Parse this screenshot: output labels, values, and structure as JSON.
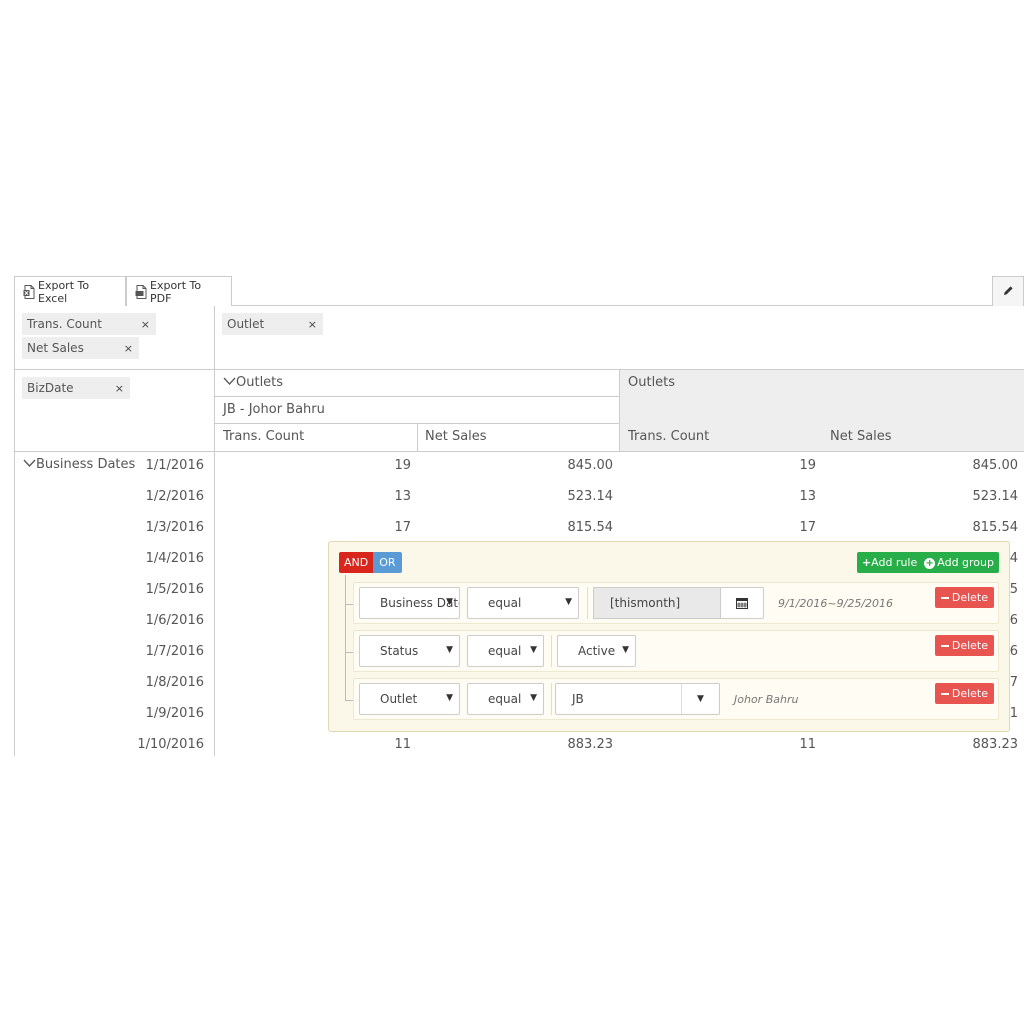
{
  "toolbar": {
    "export_excel_label": "Export To Excel",
    "export_pdf_label": "Export To PDF",
    "excel_icon": "excel-file-icon",
    "pdf_icon": "pdf-file-icon",
    "edit_icon": "pencil-icon"
  },
  "pivot": {
    "value_fields": [
      {
        "label": "Trans. Count",
        "remove": "×"
      },
      {
        "label": "Net Sales",
        "remove": "×"
      }
    ],
    "column_fields": [
      {
        "label": "Outlet",
        "remove": "×"
      }
    ],
    "row_fields": [
      {
        "label": "BizDate",
        "remove": "×"
      }
    ],
    "column_header": {
      "group_label": "Outlets",
      "outlet_label": "JB - Johor Bahru",
      "total_group_label": "Outlets",
      "measures": [
        "Trans. Count",
        "Net Sales",
        "Trans. Count",
        "Net Sales"
      ]
    },
    "row_header_label": "Business Dates",
    "rows": [
      {
        "date": "1/1/2016",
        "values": [
          "19",
          "845.00",
          "19",
          "845.00"
        ]
      },
      {
        "date": "1/2/2016",
        "values": [
          "13",
          "523.14",
          "13",
          "523.14"
        ]
      },
      {
        "date": "1/3/2016",
        "values": [
          "17",
          "815.54",
          "17",
          "815.54"
        ]
      },
      {
        "date": "1/4/2016",
        "values": [
          "",
          "",
          "",
          "4"
        ]
      },
      {
        "date": "1/5/2016",
        "values": [
          "",
          "",
          "",
          "5"
        ]
      },
      {
        "date": "1/6/2016",
        "values": [
          "",
          "",
          "",
          "6"
        ]
      },
      {
        "date": "1/7/2016",
        "values": [
          "",
          "",
          "",
          "6"
        ]
      },
      {
        "date": "1/8/2016",
        "values": [
          "",
          "",
          "",
          "7"
        ]
      },
      {
        "date": "1/9/2016",
        "values": [
          "",
          "",
          "",
          "1"
        ]
      },
      {
        "date": "1/10/2016",
        "values": [
          "11",
          "883.23",
          "11",
          "883.23"
        ]
      }
    ]
  },
  "filter": {
    "and_label": "AND",
    "or_label": "OR",
    "add_rule_label": "Add rule",
    "add_group_label": "Add group",
    "delete_label": "Delete",
    "rules": [
      {
        "field": "Business Date",
        "operator": "equal",
        "value": "[thismonth]",
        "hint": "9/1/2016~9/25/2016",
        "value_type": "date"
      },
      {
        "field": "Status",
        "operator": "equal",
        "value": "Active",
        "hint": "",
        "value_type": "select"
      },
      {
        "field": "Outlet",
        "operator": "equal",
        "value": "JB",
        "hint": "Johor Bahru",
        "value_type": "combo"
      }
    ]
  },
  "colors": {
    "and_button": "#d9261c",
    "or_button": "#5b9bd5",
    "add_button": "#27ae49",
    "delete_button": "#e85450",
    "filter_panel": "#fcf8e9"
  }
}
